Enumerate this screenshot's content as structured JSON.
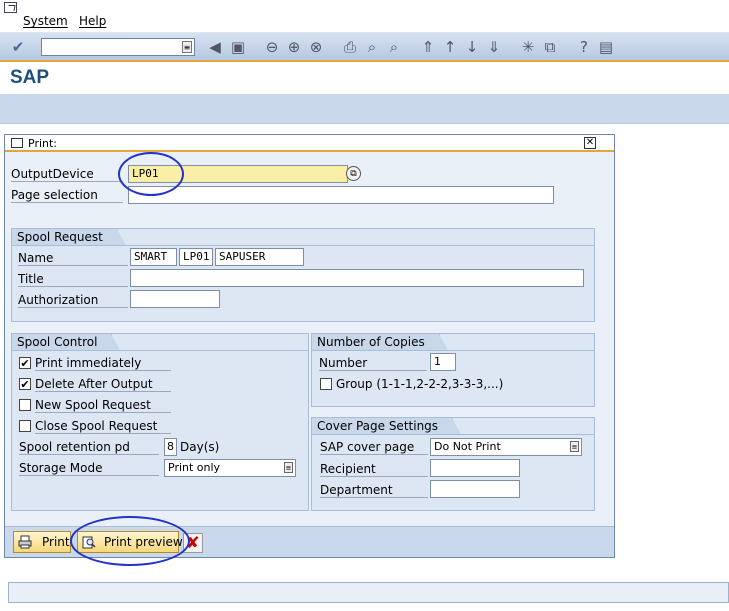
{
  "menu": {
    "system": "System",
    "help": "Help"
  },
  "toolbar": {
    "command_field_value": "",
    "icons": [
      "enter-icon",
      "save-icon",
      "back-icon",
      "exit-icon",
      "cancel-icon",
      "print-icon",
      "find-icon",
      "find-next-icon",
      "first-page-icon",
      "previous-page-icon",
      "next-page-icon",
      "last-page-icon",
      "new-session-icon",
      "shortcut-icon",
      "help-icon",
      "layout-icon"
    ]
  },
  "title": "SAP",
  "dialog": {
    "title": "Print:",
    "output_device_label": "OutputDevice",
    "output_device_value": "LP01",
    "page_selection_label": "Page selection",
    "page_selection_value": "",
    "spool_request": {
      "header": "Spool Request",
      "name_label": "Name",
      "name_part1": "SMART",
      "name_part2": "LP01",
      "name_part3": "SAPUSER",
      "title_label": "Title",
      "title_value": "",
      "authorization_label": "Authorization",
      "authorization_value": ""
    },
    "spool_control": {
      "header": "Spool Control",
      "print_immediately": {
        "label": "Print immediately",
        "checked": true
      },
      "delete_after_output": {
        "label": "Delete After Output",
        "checked": true
      },
      "new_spool_request": {
        "label": "New Spool Request",
        "checked": false
      },
      "close_spool_request": {
        "label": "Close Spool Request",
        "checked": false
      },
      "retention_label": "Spool retention pd",
      "retention_value": "8",
      "retention_unit": "Day(s)",
      "storage_mode_label": "Storage Mode",
      "storage_mode_value": "Print only"
    },
    "copies": {
      "header": "Number of Copies",
      "number_label": "Number",
      "number_value": "1",
      "group_label": "Group (1-1-1,2-2-2,3-3-3,...)",
      "group_checked": false
    },
    "cover_page": {
      "header": "Cover Page Settings",
      "sap_cover_label": "SAP cover page",
      "sap_cover_value": "Do Not Print",
      "recipient_label": "Recipient",
      "recipient_value": "",
      "department_label": "Department",
      "department_value": ""
    },
    "buttons": {
      "print": "Print",
      "print_preview": "Print preview"
    }
  },
  "colors": {
    "accent_orange": "#e3a63a",
    "title_blue": "#1f4f7c",
    "annotation_blue": "#2233cc"
  }
}
